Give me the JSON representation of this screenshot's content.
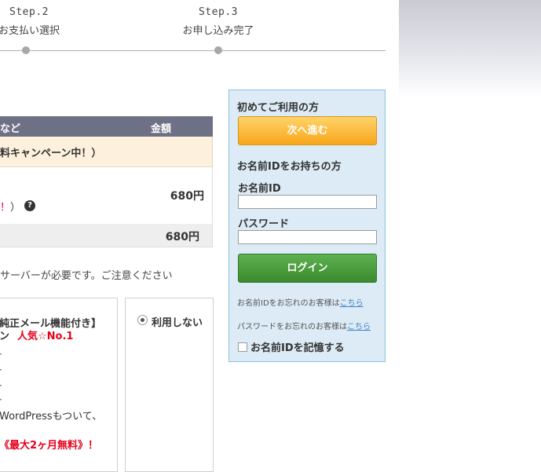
{
  "steps": [
    {
      "number": "Step.2",
      "label": "お支払い選択"
    },
    {
      "number": "Step.3",
      "label": "お申し込み完了"
    }
  ],
  "table": {
    "header_plan": "など",
    "header_amount": "金額",
    "campaign": "料キャンペーン中！）",
    "price": "680円",
    "note_prefix": "",
    "note_red": "！",
    "note_suffix": "）",
    "total": "680円"
  },
  "server_note": "サーバーが必要です。ご注意ください",
  "option_left": {
    "title_line1": "純正メール機能付き】",
    "title_line2": "ン",
    "popular_badge": "人気☆No.1",
    "wordpress": "WordPressもついて、",
    "promo": "《最大2ヶ月無料》！"
  },
  "option_right": {
    "label": "利用しない"
  },
  "login": {
    "first_time_heading": "初めてご利用の方",
    "next_button": "次へ進む",
    "has_id_heading": "お名前IDをお持ちの方",
    "id_label": "お名前ID",
    "password_label": "パスワード",
    "login_button": "ログイン",
    "forgot_id_text": "お名前IDをお忘れのお客様は",
    "forgot_id_link": "こちら",
    "forgot_pw_text": "パスワードをお忘れのお客様は",
    "forgot_pw_link": "こちら",
    "remember_label": "お名前IDを記憶する"
  },
  "colors": {
    "table_header": "#6e7185",
    "campaign_bg": "#fdf0dd",
    "panel_bg": "#dcebf5",
    "next_button": "#f7a619",
    "login_button": "#3b8a2e",
    "accent_red": "#e5001c"
  }
}
